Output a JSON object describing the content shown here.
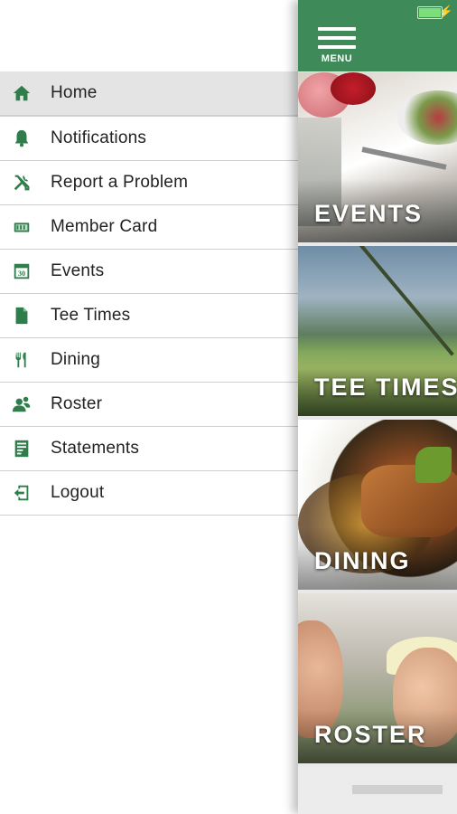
{
  "status_bar": {
    "battery_icon": "battery-charging-icon"
  },
  "header": {
    "menu_label": "MENU",
    "menu_icon": "hamburger-icon"
  },
  "drawer": {
    "items": [
      {
        "label": "Home",
        "icon": "home-icon",
        "active": true
      },
      {
        "label": "Notifications",
        "icon": "bell-icon"
      },
      {
        "label": "Report a Problem",
        "icon": "tools-icon"
      },
      {
        "label": "Member Card",
        "icon": "card-icon"
      },
      {
        "label": "Events",
        "icon": "calendar-icon",
        "icon_text": "30"
      },
      {
        "label": "Tee Times",
        "icon": "document-icon"
      },
      {
        "label": "Dining",
        "icon": "fork-knife-icon"
      },
      {
        "label": "Roster",
        "icon": "people-icon"
      },
      {
        "label": "Statements",
        "icon": "statement-icon"
      },
      {
        "label": "Logout",
        "icon": "logout-icon"
      }
    ]
  },
  "tiles": [
    {
      "label": "EVENTS"
    },
    {
      "label": "TEE TIMES"
    },
    {
      "label": "DINING"
    },
    {
      "label": "ROSTER"
    }
  ],
  "colors": {
    "brand": "#3e8a58",
    "icon": "#2e7d4a"
  }
}
